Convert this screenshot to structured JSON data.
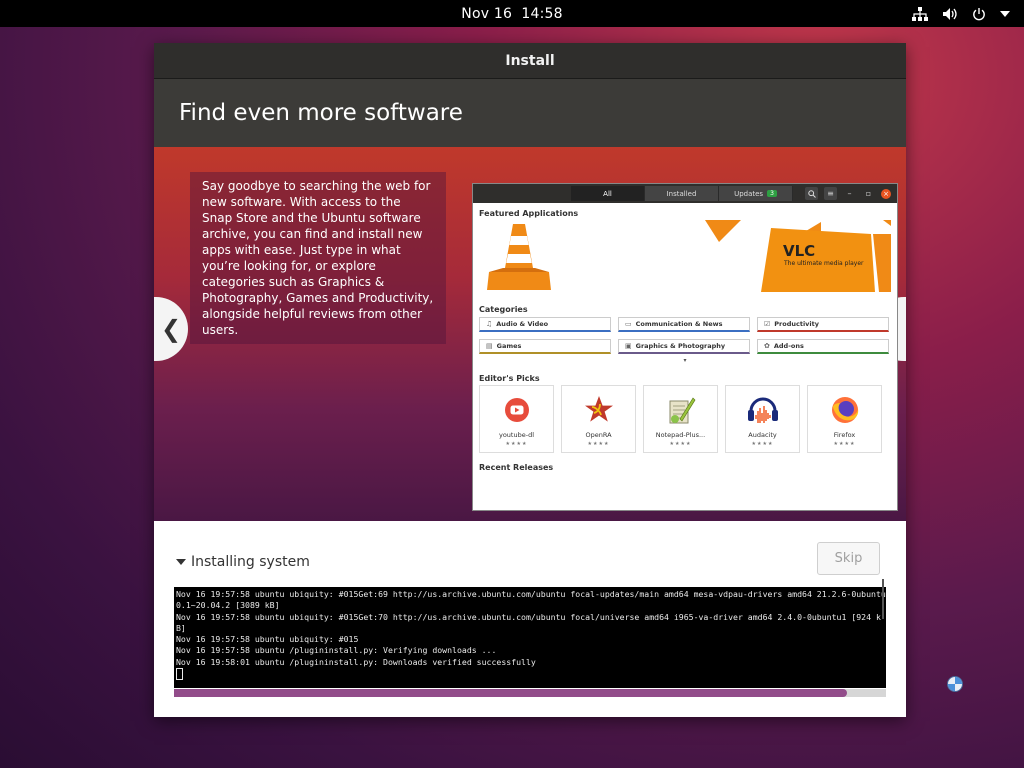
{
  "topbar": {
    "date": "Nov 16",
    "time": "14:58"
  },
  "window": {
    "title": "Install",
    "heading": "Find even more software"
  },
  "slide": {
    "text": "Say goodbye to searching the web for new software. With access to the Snap Store and the Ubuntu software archive, you can find and install new apps with ease. Just type in what you’re looking for, or explore categories such as Graphics & Photography, Games and Productivity, alongside helpful reviews from other users.",
    "prev_glyph": "❮",
    "next_glyph": "❯",
    "screenshot": {
      "tabs": [
        {
          "label": "All"
        },
        {
          "label": "Installed"
        },
        {
          "label": "Updates",
          "badge": "3"
        }
      ],
      "featured_label": "Featured Applications",
      "featured_app": "VLC",
      "featured_tagline": "The ultimate media player",
      "categories_label": "Categories",
      "categories": [
        {
          "label": "Audio & Video",
          "color": "#3b6fc2",
          "icon": "♫"
        },
        {
          "label": "Communication & News",
          "color": "#3b6fc2",
          "icon": "▭"
        },
        {
          "label": "Productivity",
          "color": "#c0392b",
          "icon": "☑"
        },
        {
          "label": "Games",
          "color": "#b09028",
          "icon": "▤"
        },
        {
          "label": "Graphics & Photography",
          "color": "#6a5a8a",
          "icon": "▣"
        },
        {
          "label": "Add-ons",
          "color": "#3d8b3d",
          "icon": "✿"
        }
      ],
      "editors_label": "Editor's Picks",
      "picks": [
        {
          "name": "youtube-dl",
          "stars": "★★★★"
        },
        {
          "name": "OpenRA",
          "stars": "★★★★"
        },
        {
          "name": "Notepad-Plus...",
          "stars": "★★★★"
        },
        {
          "name": "Audacity",
          "stars": "★★★★"
        },
        {
          "name": "Firefox",
          "stars": "★★★★"
        }
      ],
      "recent_label": "Recent Releases"
    }
  },
  "progress": {
    "title": "Installing system",
    "skip_label": "Skip",
    "fraction": 0.945,
    "log": "Nov 16 19:57:58 ubuntu ubiquity: #015Get:69 http://us.archive.ubuntu.com/ubuntu focal-updates/main amd64 mesa-vdpau-drivers amd64 21.2.6-0ubuntu0.1~20.04.2 [3089 kB]\nNov 16 19:57:58 ubuntu ubiquity: #015Get:70 http://us.archive.ubuntu.com/ubuntu focal/universe amd64 i965-va-driver amd64 2.4.0-0ubuntu1 [924 kB]\nNov 16 19:57:58 ubuntu ubiquity: #015\nNov 16 19:57:58 ubuntu /plugininstall.py: Verifying downloads ...\nNov 16 19:58:01 ubuntu /plugininstall.py: Downloads verified successfully\n"
  },
  "colors": {
    "accent": "#e95420",
    "progress": "#924c8a"
  }
}
